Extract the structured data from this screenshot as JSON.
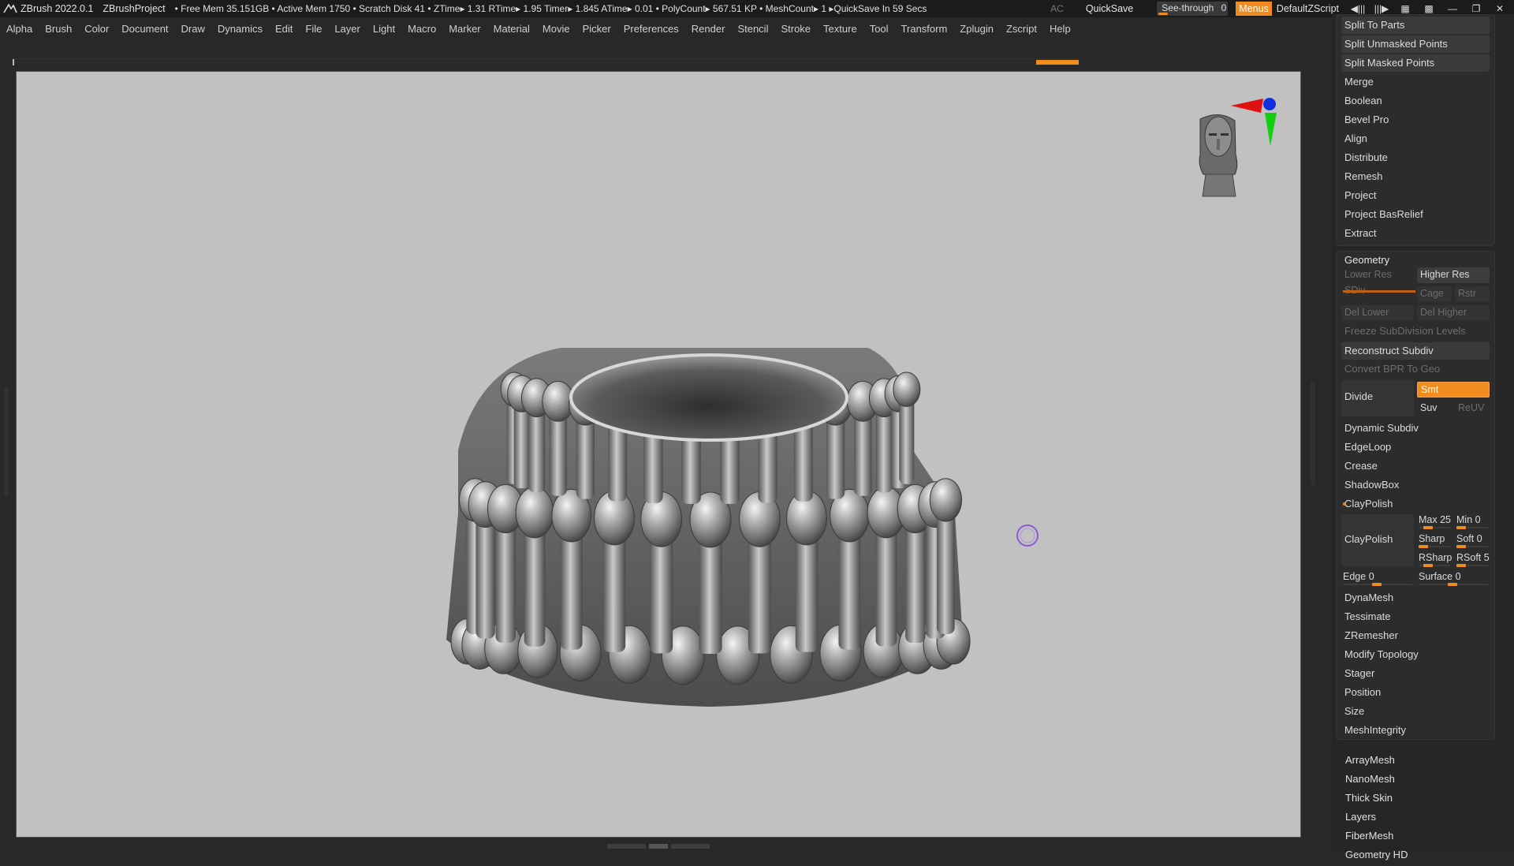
{
  "titlebar": {
    "app": "ZBrush 2022.0.1",
    "project": "ZBrushProject",
    "stats": "• Free Mem 35.151GB • Active Mem 1750 • Scratch Disk 41 •  ZTime▸ 1.31 RTime▸ 1.95 Timer▸ 1.845 ATime▸ 0.01 • PolyCount▸ 567.51 KP  • MeshCount▸ 1  ▸QuickSave In 59 Secs",
    "ac": "AC",
    "quicksave": "QuickSave",
    "see_through_label": "See-through",
    "see_through_value": "0",
    "see_through_level": 0,
    "menus": "Menus",
    "default_zscript": "DefaultZScript"
  },
  "menubar": [
    "Alpha",
    "Brush",
    "Color",
    "Document",
    "Draw",
    "Dynamics",
    "Edit",
    "File",
    "Layer",
    "Light",
    "Macro",
    "Marker",
    "Material",
    "Movie",
    "Picker",
    "Preferences",
    "Render",
    "Stencil",
    "Stroke",
    "Texture",
    "Tool",
    "Transform",
    "Zplugin",
    "Zscript",
    "Help"
  ],
  "subtool_panel": {
    "items": [
      {
        "label": "Split To Parts",
        "style": "btn"
      },
      {
        "label": "Split Unmasked Points",
        "style": "btn"
      },
      {
        "label": "Split Masked Points",
        "style": "btn"
      },
      {
        "label": "Merge",
        "style": "plain"
      },
      {
        "label": "Boolean",
        "style": "plain"
      },
      {
        "label": "Bevel Pro",
        "style": "plain"
      },
      {
        "label": "Align",
        "style": "plain"
      },
      {
        "label": "Distribute",
        "style": "plain"
      },
      {
        "label": "Remesh",
        "style": "plain"
      },
      {
        "label": "Project",
        "style": "plain"
      },
      {
        "label": "Project BasRelief",
        "style": "plain"
      },
      {
        "label": "Extract",
        "style": "plain"
      }
    ]
  },
  "geometry": {
    "title": "Geometry",
    "lower_res": "Lower Res",
    "higher_res": "Higher Res",
    "sdiv": "SDiv",
    "cage": "Cage",
    "rstr": "Rstr",
    "del_lower": "Del Lower",
    "del_higher": "Del Higher",
    "freeze": "Freeze SubDivision Levels",
    "reconstruct": "Reconstruct Subdiv",
    "convert_bpr": "Convert BPR To Geo",
    "divide": "Divide",
    "smt": "Smt",
    "suv": "Suv",
    "reuv": "ReUV",
    "dynamic_subdiv": "Dynamic Subdiv",
    "edgeloop": "EdgeLoop",
    "crease": "Crease",
    "shadowbox": "ShadowBox",
    "claypolish_header": "ClayPolish",
    "claypolish_btn": "ClayPolish",
    "sliders": {
      "max": {
        "label": "Max",
        "value": "25",
        "level": 0.25
      },
      "min": {
        "label": "Min",
        "value": "0",
        "level": 0
      },
      "sharp": {
        "label": "Sharp",
        "value": "",
        "level": 0
      },
      "soft": {
        "label": "Soft",
        "value": "0",
        "level": 0
      },
      "rsharp": {
        "label": "RSharp",
        "value": "",
        "level": 0.25
      },
      "rsoft": {
        "label": "RSoft",
        "value": "5",
        "level": 0.05
      },
      "edge": {
        "label": "Edge",
        "value": "0",
        "level": 0.5
      },
      "surface": {
        "label": "Surface",
        "value": "0",
        "level": 0.5
      }
    },
    "after": [
      "DynaMesh",
      "Tessimate",
      "ZRemesher",
      "Modify Topology",
      "Stager",
      "Position",
      "Size",
      "MeshIntegrity"
    ]
  },
  "extra_sections": [
    "ArrayMesh",
    "NanoMesh",
    "Thick Skin",
    "Layers",
    "FiberMesh",
    "Geometry HD"
  ],
  "navigator_icon": "head-navigator-icon",
  "colors": {
    "accent": "#f08c1e",
    "canvas": "#c1c1c1",
    "axis_x": "#e01010",
    "axis_y": "#10d010",
    "axis_z": "#1030e0",
    "cursor": "#8a5ad0"
  }
}
